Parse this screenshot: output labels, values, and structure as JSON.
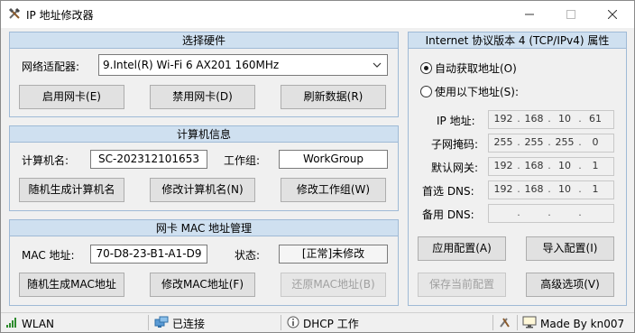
{
  "window": {
    "title": "IP 地址修改器"
  },
  "hardware": {
    "header": "选择硬件",
    "adapter_label": "网络适配器:",
    "adapter_value": "9.Intel(R) Wi-Fi 6 AX201 160MHz",
    "enable_btn": "启用网卡(E)",
    "disable_btn": "禁用网卡(D)",
    "refresh_btn": "刷新数据(R)"
  },
  "computer": {
    "header": "计算机信息",
    "name_label": "计算机名:",
    "name_value": "SC-202312101653",
    "workgroup_label": "工作组:",
    "workgroup_value": "WorkGroup",
    "random_name_btn": "随机生成计算机名",
    "modify_name_btn": "修改计算机名(N)",
    "modify_workgroup_btn": "修改工作组(W)"
  },
  "mac": {
    "header": "网卡 MAC 地址管理",
    "mac_label": "MAC 地址:",
    "mac_value": "70-D8-23-B1-A1-D9",
    "status_label": "状态:",
    "status_value": "[正常]未修改",
    "random_btn": "随机生成MAC地址",
    "modify_btn": "修改MAC地址(F)",
    "restore_btn": "还原MAC地址(B)"
  },
  "ipv4": {
    "header": "Internet 协议版本 4 (TCP/IPv4) 属性",
    "auto_label": "自动获取地址(O)",
    "manual_label": "使用以下地址(S):",
    "ip_label": "IP 地址:",
    "ip": [
      "192",
      "168",
      "10",
      "61"
    ],
    "mask_label": "子网掩码:",
    "mask": [
      "255",
      "255",
      "255",
      "0"
    ],
    "gateway_label": "默认网关:",
    "gateway": [
      "192",
      "168",
      "10",
      "1"
    ],
    "dns1_label": "首选 DNS:",
    "dns1": [
      "192",
      "168",
      "10",
      "1"
    ],
    "dns2_label": "备用 DNS:",
    "dns2": [
      "",
      "",
      "",
      ""
    ],
    "apply_btn": "应用配置(A)",
    "import_btn": "导入配置(I)",
    "save_btn": "保存当前配置",
    "advanced_btn": "高级选项(V)"
  },
  "statusbar": {
    "adapter": "WLAN",
    "connection": "已连接",
    "dhcp": "DHCP 工作",
    "credit": "Made By kn007"
  }
}
